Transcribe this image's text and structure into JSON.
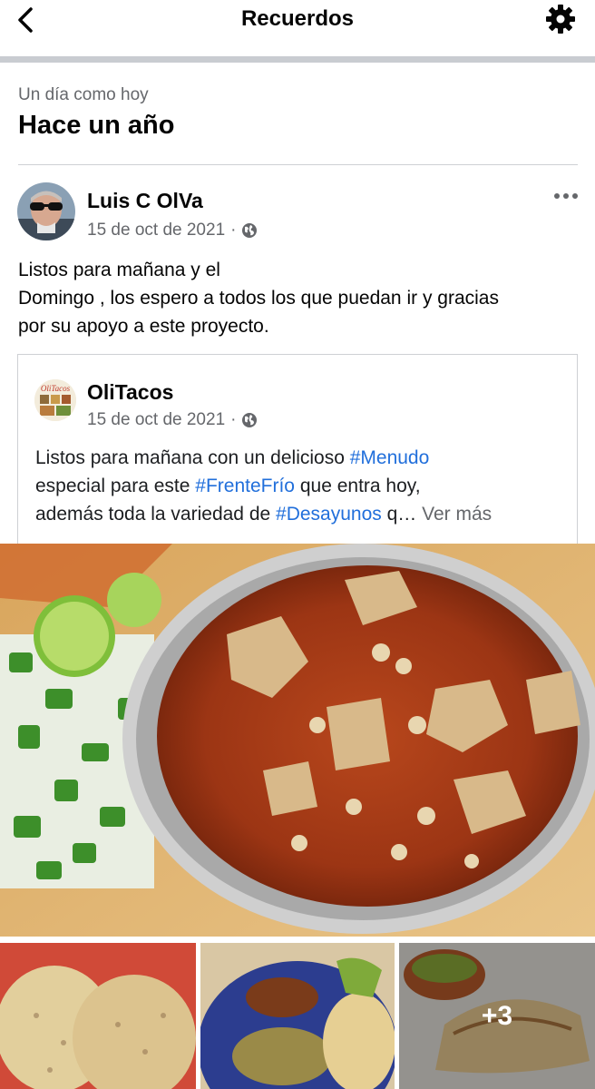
{
  "header": {
    "title": "Recuerdos",
    "back_icon": "chevron-left-icon",
    "settings_icon": "gear-icon"
  },
  "memories": {
    "subtitle": "Un día como hoy",
    "title": "Hace un año"
  },
  "post": {
    "author": "Luis C OlVa",
    "date": "15 de oct de 2021",
    "separator": "·",
    "privacy_icon": "globe-icon",
    "options_icon": "more-horizontal-icon",
    "text_line1": "Listos para mañana y el",
    "text_line2": "Domingo , los espero a todos los que puedan ir y gracias",
    "text_line3": "por su apoyo a este proyecto."
  },
  "shared_post": {
    "page_name": "OliTacos",
    "avatar_text": "OliTacos",
    "date": "15 de oct de 2021",
    "separator": "·",
    "privacy_icon": "globe-icon",
    "text_1": "Listos para mañana con un delicioso ",
    "hashtag_1": "#Menudo",
    "text_2": "especial para este ",
    "hashtag_2": "#FrenteFrío",
    "text_3": " que entra hoy,",
    "text_4": "además toda la variedad de ",
    "hashtag_3": "#Desayunos",
    "text_5": " q…",
    "see_more": "Ver más"
  },
  "photos": {
    "main_alt": "Menudo soup bowl with lime, onion and chiles",
    "extra_count": "+3"
  },
  "colors": {
    "hashtag": "#216fdb",
    "secondary_text": "#65676b",
    "separator": "#c9ccd1"
  }
}
